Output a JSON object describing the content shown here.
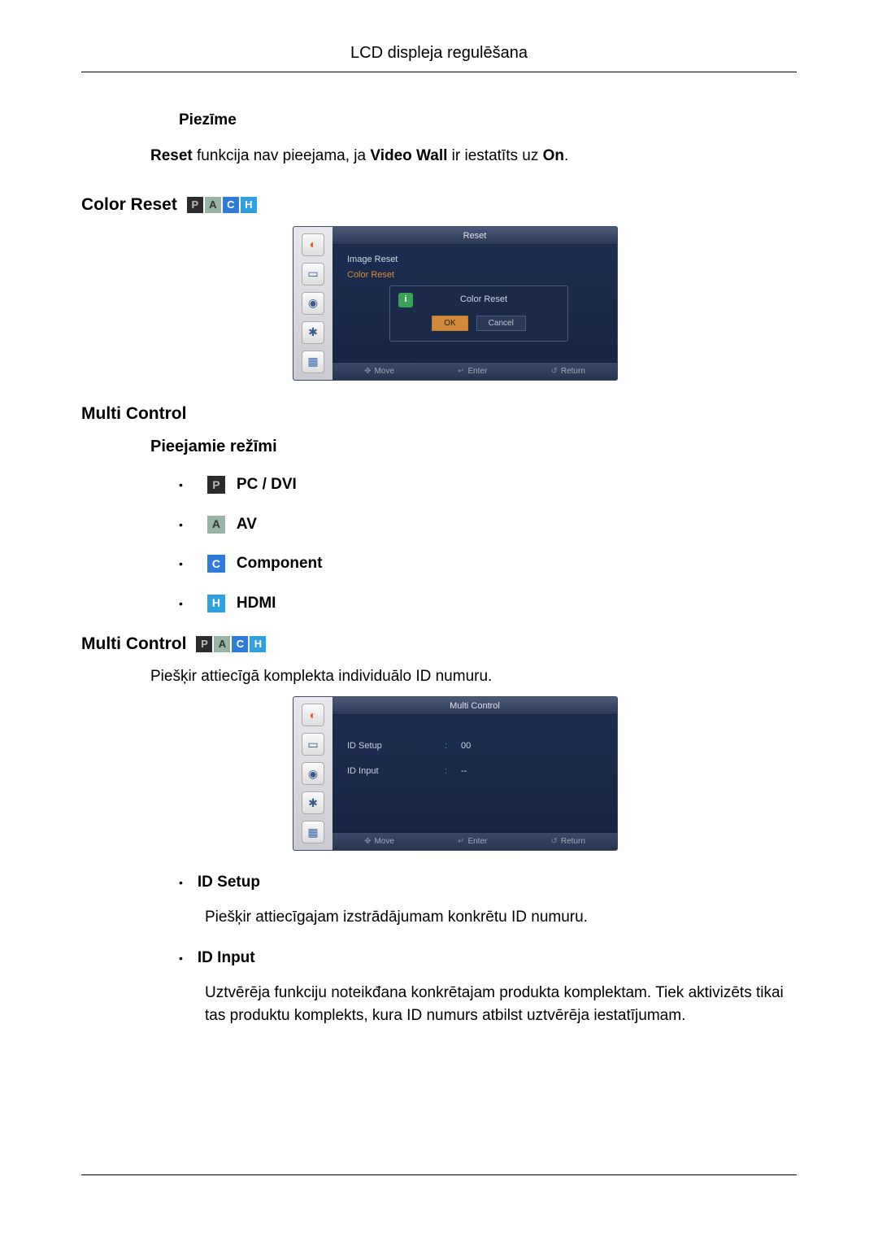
{
  "header": {
    "title": "LCD displeja regulēšana"
  },
  "note": {
    "heading": "Piezīme",
    "prefix_bold": "Reset",
    "mid_text": " funkcija nav pieejama, ja ",
    "mid_bold": "Video Wall",
    "mid_text2": " ir iestatīts uz ",
    "end_bold": "On",
    "end_punct": "."
  },
  "color_reset": {
    "heading": "Color Reset",
    "osd": {
      "title": "Reset",
      "items": [
        "Image Reset",
        "Color Reset"
      ],
      "dialog": {
        "title": "Color Reset",
        "ok": "OK",
        "cancel": "Cancel"
      },
      "footer": {
        "move": "Move",
        "enter": "Enter",
        "return": "Return"
      }
    }
  },
  "multi_control_section": {
    "heading": "Multi Control",
    "modes_heading": "Pieejamie režīmi",
    "modes": [
      {
        "icon": "P",
        "badge": "badge-p",
        "label": "PC / DVI"
      },
      {
        "icon": "A",
        "badge": "badge-a",
        "label": "AV"
      },
      {
        "icon": "C",
        "badge": "badge-c",
        "label": "Component"
      },
      {
        "icon": "H",
        "badge": "badge-h",
        "label": "HDMI"
      }
    ]
  },
  "multi_control_detail": {
    "heading": "Multi Control",
    "desc": "Piešķir attiecīgā komplekta individuālo ID numuru.",
    "osd": {
      "title": "Multi Control",
      "rows": [
        {
          "label": "ID Setup",
          "value": "00"
        },
        {
          "label": "ID Input",
          "value": "--"
        }
      ],
      "footer": {
        "move": "Move",
        "enter": "Enter",
        "return": "Return"
      }
    },
    "items": [
      {
        "title": "ID Setup",
        "body": "Piešķir attiecīgajam izstrādājumam konkrētu ID numuru."
      },
      {
        "title": "ID Input",
        "body": "Uztvērēja funkciju noteikđana konkrētajam produkta komplektam. Tiek aktivizēts tikai tas produktu komplekts, kura ID numurs atbilst uztvērēja iestatījumam."
      }
    ]
  }
}
